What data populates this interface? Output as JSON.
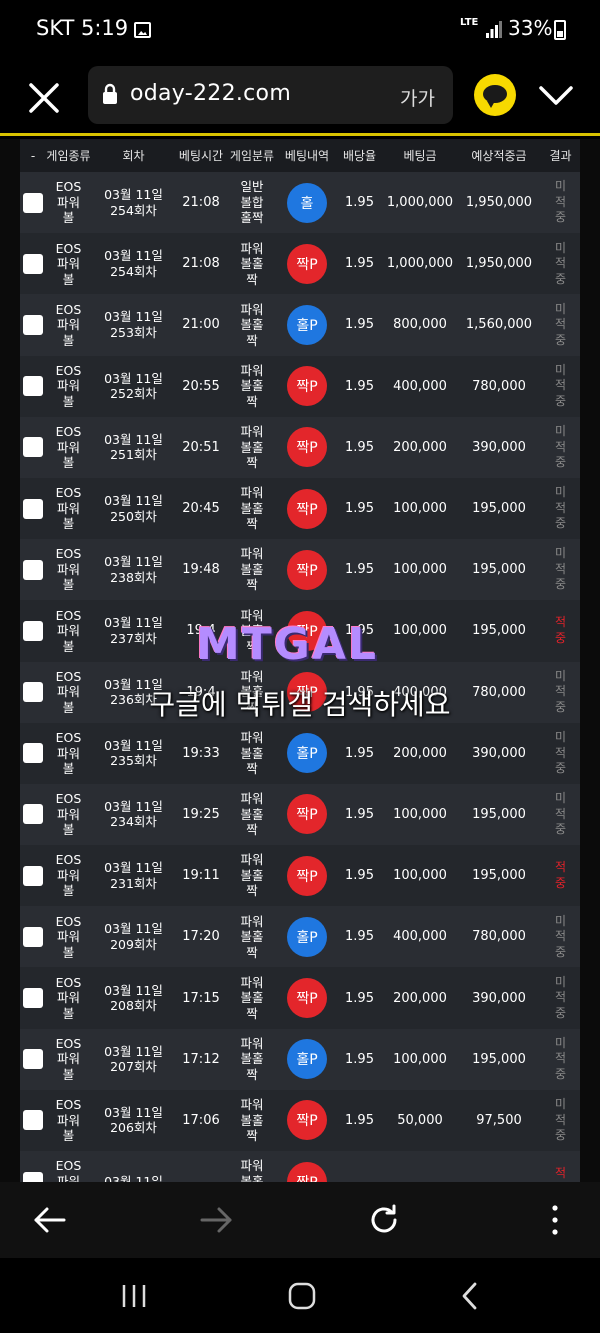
{
  "status_bar": {
    "carrier": "SKT",
    "time": "5:19",
    "network": "LTE",
    "battery": "33%"
  },
  "browser": {
    "url": "oday-222.com",
    "text_size_label": "가가"
  },
  "table": {
    "headers": [
      "-",
      "게임종류",
      "회차",
      "베팅시간",
      "게임분류",
      "베팅내역",
      "배당율",
      "베팅금",
      "예상적중금",
      "결과"
    ],
    "rows": [
      {
        "game": "EOS 파워볼",
        "date": "03월 11일",
        "round": "254회차",
        "time": "21:08",
        "category": "일반 볼합 홀짝",
        "bet": "홀",
        "bet_color": "blue",
        "odds": "1.95",
        "amount": "1,000,000",
        "expected": "1,950,000",
        "result": "미적중"
      },
      {
        "game": "EOS 파워볼",
        "date": "03월 11일",
        "round": "254회차",
        "time": "21:08",
        "category": "파워 볼홀 짝",
        "bet": "짝P",
        "bet_color": "red",
        "odds": "1.95",
        "amount": "1,000,000",
        "expected": "1,950,000",
        "result": "미적중"
      },
      {
        "game": "EOS 파워볼",
        "date": "03월 11일",
        "round": "253회차",
        "time": "21:00",
        "category": "파워 볼홀 짝",
        "bet": "홀P",
        "bet_color": "blue",
        "odds": "1.95",
        "amount": "800,000",
        "expected": "1,560,000",
        "result": "미적중"
      },
      {
        "game": "EOS 파워볼",
        "date": "03월 11일",
        "round": "252회차",
        "time": "20:55",
        "category": "파워 볼홀 짝",
        "bet": "짝P",
        "bet_color": "red",
        "odds": "1.95",
        "amount": "400,000",
        "expected": "780,000",
        "result": "미적중"
      },
      {
        "game": "EOS 파워볼",
        "date": "03월 11일",
        "round": "251회차",
        "time": "20:51",
        "category": "파워 볼홀 짝",
        "bet": "짝P",
        "bet_color": "red",
        "odds": "1.95",
        "amount": "200,000",
        "expected": "390,000",
        "result": "미적중"
      },
      {
        "game": "EOS 파워볼",
        "date": "03월 11일",
        "round": "250회차",
        "time": "20:45",
        "category": "파워 볼홀 짝",
        "bet": "짝P",
        "bet_color": "red",
        "odds": "1.95",
        "amount": "100,000",
        "expected": "195,000",
        "result": "미적중"
      },
      {
        "game": "EOS 파워볼",
        "date": "03월 11일",
        "round": "238회차",
        "time": "19:48",
        "category": "파워 볼홀 짝",
        "bet": "짝P",
        "bet_color": "red",
        "odds": "1.95",
        "amount": "100,000",
        "expected": "195,000",
        "result": "미적중"
      },
      {
        "game": "EOS 파워볼",
        "date": "03월 11일",
        "round": "237회차",
        "time": "19:4",
        "category": "파워 볼홀 짝",
        "bet": "짝P",
        "bet_color": "red",
        "odds": "1.95",
        "amount": "100,000",
        "expected": "195,000",
        "result": "적중"
      },
      {
        "game": "EOS 파워볼",
        "date": "03월 11일",
        "round": "236회차",
        "time": "19:4",
        "category": "파워 볼홀 짝",
        "bet": "짝P",
        "bet_color": "red",
        "odds": "1.95",
        "amount": "400,000",
        "expected": "780,000",
        "result": "미적중"
      },
      {
        "game": "EOS 파워볼",
        "date": "03월 11일",
        "round": "235회차",
        "time": "19:33",
        "category": "파워 볼홀 짝",
        "bet": "홀P",
        "bet_color": "blue",
        "odds": "1.95",
        "amount": "200,000",
        "expected": "390,000",
        "result": "미적중"
      },
      {
        "game": "EOS 파워볼",
        "date": "03월 11일",
        "round": "234회차",
        "time": "19:25",
        "category": "파워 볼홀 짝",
        "bet": "짝P",
        "bet_color": "red",
        "odds": "1.95",
        "amount": "100,000",
        "expected": "195,000",
        "result": "미적중"
      },
      {
        "game": "EOS 파워볼",
        "date": "03월 11일",
        "round": "231회차",
        "time": "19:11",
        "category": "파워 볼홀 짝",
        "bet": "짝P",
        "bet_color": "red",
        "odds": "1.95",
        "amount": "100,000",
        "expected": "195,000",
        "result": "적중"
      },
      {
        "game": "EOS 파워볼",
        "date": "03월 11일",
        "round": "209회차",
        "time": "17:20",
        "category": "파워 볼홀 짝",
        "bet": "홀P",
        "bet_color": "blue",
        "odds": "1.95",
        "amount": "400,000",
        "expected": "780,000",
        "result": "미적중"
      },
      {
        "game": "EOS 파워볼",
        "date": "03월 11일",
        "round": "208회차",
        "time": "17:15",
        "category": "파워 볼홀 짝",
        "bet": "짝P",
        "bet_color": "red",
        "odds": "1.95",
        "amount": "200,000",
        "expected": "390,000",
        "result": "미적중"
      },
      {
        "game": "EOS 파워볼",
        "date": "03월 11일",
        "round": "207회차",
        "time": "17:12",
        "category": "파워 볼홀 짝",
        "bet": "홀P",
        "bet_color": "blue",
        "odds": "1.95",
        "amount": "100,000",
        "expected": "195,000",
        "result": "미적중"
      },
      {
        "game": "EOS 파워볼",
        "date": "03월 11일",
        "round": "206회차",
        "time": "17:06",
        "category": "파워 볼홀 짝",
        "bet": "짝P",
        "bet_color": "red",
        "odds": "1.95",
        "amount": "50,000",
        "expected": "97,500",
        "result": "미적중"
      },
      {
        "game": "EOS 파워볼",
        "date": "03월 11일",
        "round": "",
        "time": "",
        "category": "파워 볼홀 짝",
        "bet": "짝P",
        "bet_color": "red",
        "odds": "",
        "amount": "",
        "expected": "",
        "result": "적중"
      }
    ]
  },
  "watermark": {
    "logo": "MTGAL",
    "text": "구글에 먹튀갤 검색하세요"
  },
  "colors": {
    "accent_line": "#d9c300",
    "kakao": "#f7d900",
    "bet_blue": "#1f77e0",
    "bet_red": "#e3262b",
    "win_red": "#e4222a"
  }
}
